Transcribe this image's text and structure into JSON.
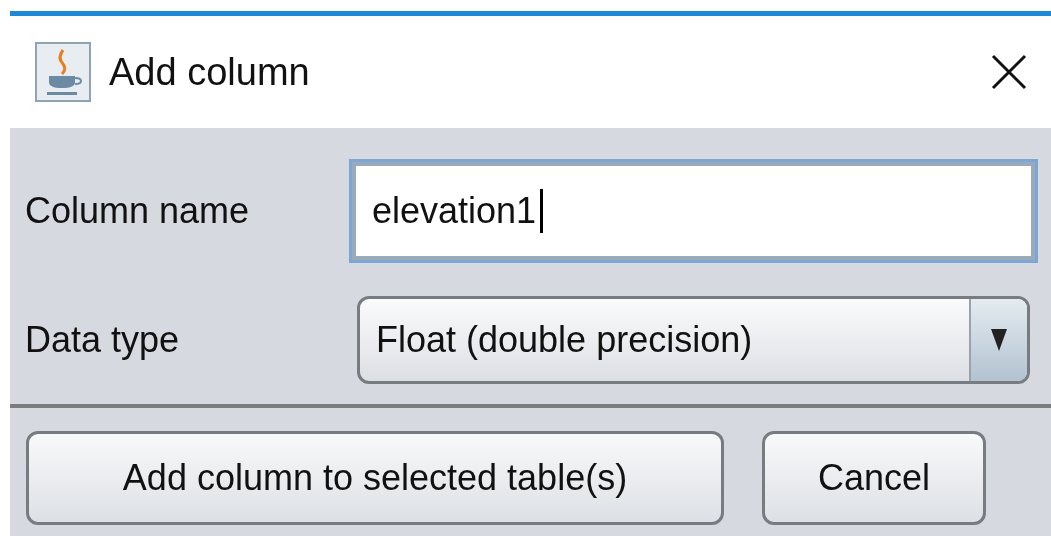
{
  "window": {
    "title": "Add column"
  },
  "fields": [
    {
      "kind": "text",
      "label": "Column name",
      "value": "elevation1",
      "focused": true
    },
    {
      "kind": "dropdown",
      "label": "Data type",
      "value": "Float (double precision)"
    }
  ],
  "buttons": [
    "Add column to selected table(s)",
    "Cancel"
  ]
}
